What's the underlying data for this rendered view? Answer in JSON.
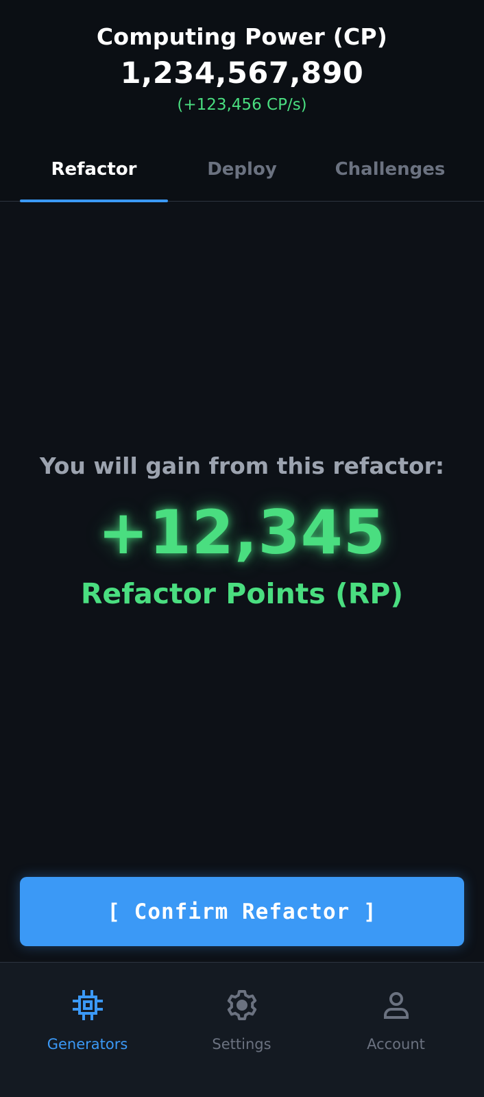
{
  "header": {
    "title": "Computing Power (CP)",
    "value": "1,234,567,890",
    "rate": "(+123,456 CP/s)"
  },
  "tabs": [
    {
      "label": "Refactor",
      "active": true
    },
    {
      "label": "Deploy",
      "active": false
    },
    {
      "label": "Challenges",
      "active": false
    }
  ],
  "refactor": {
    "gain_label": "You will gain from this refactor:",
    "gain_value": "+12,345",
    "gain_unit": "Refactor Points (RP)",
    "confirm_label": "[ Confirm Refactor ]"
  },
  "bottom_nav": [
    {
      "label": "Generators",
      "icon": "cpu-chip-icon",
      "active": true
    },
    {
      "label": "Settings",
      "icon": "gear-icon",
      "active": false
    },
    {
      "label": "Account",
      "icon": "user-icon",
      "active": false
    }
  ],
  "colors": {
    "background": "#0d1117",
    "accent_blue": "#3b99f6",
    "accent_green": "#4ade80",
    "muted_text": "#6b7280"
  }
}
